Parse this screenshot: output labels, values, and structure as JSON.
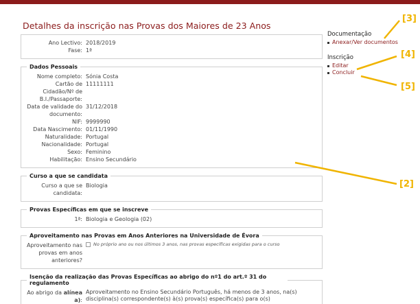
{
  "page_title": "Detalhes da inscrição nas Provas dos Maiores de 23 Anos",
  "summary": {
    "ano_lectivo_label": "Ano Lectivo:",
    "ano_lectivo_value": "2018/2019",
    "fase_label": "Fase:",
    "fase_value": "1ª"
  },
  "dados_pessoais": {
    "legend": "Dados Pessoais",
    "rows": [
      {
        "label": "Nome completo:",
        "value": "Sónia Costa"
      },
      {
        "label": "Cartão de Cidadão/Nº de B.I./Passaporte:",
        "value": "11111111"
      },
      {
        "label": "Data de validade do documento:",
        "value": "31/12/2018"
      },
      {
        "label": "NIF:",
        "value": "9999990"
      },
      {
        "label": "Data Nascimento:",
        "value": "01/11/1990"
      },
      {
        "label": "Naturalidade:",
        "value": "Portugal"
      },
      {
        "label": "Nacionalidade:",
        "value": "Portugal"
      },
      {
        "label": "Sexo:",
        "value": "Feminino"
      },
      {
        "label": "Habilitação:",
        "value": "Ensino Secundário"
      }
    ]
  },
  "curso": {
    "legend": "Curso a que se candidata",
    "label": "Curso a que se candidata:",
    "value": "Biologia"
  },
  "provas": {
    "legend": "Provas Específicas em que se inscreve",
    "label": "1ª:",
    "value": "Biologia e Geologia (02)"
  },
  "aproveitamento": {
    "legend": "Aproveitamento nas Provas em Anos Anteriores na Universidade de Évora",
    "label": "Aproveitamento nas provas em anos anteriores?",
    "note": "No próprio ano ou nos últimos 3 anos, nas provas específicas exigidas para o curso"
  },
  "isencao": {
    "legend": "Isenção da realização das Provas Específicas ao abrigo do nº1 do art.º 31 do regulamento",
    "label_prefix": "Ao abrigo da",
    "label_bold": "alínea a)",
    "label_suffix": ":",
    "value": "Aproveitamento no Ensino Secundário Português, há menos de 3 anos, na(s) disciplina(s) correspondente(s) à(s) prova(s) específica(s) para o(s)"
  },
  "sidebar": {
    "documentacao_title": "Documentação",
    "documentacao_link": "Anexar/Ver documentos",
    "inscricao_title": "Inscrição",
    "editar_link": "Editar",
    "concluir_link": "Concluir"
  },
  "callouts": {
    "c2": "[2]",
    "c3": "[3]",
    "c4": "[4]",
    "c5": "[5]"
  },
  "colors": {
    "brand": "#8b1b1b",
    "callout": "#f0b400"
  }
}
